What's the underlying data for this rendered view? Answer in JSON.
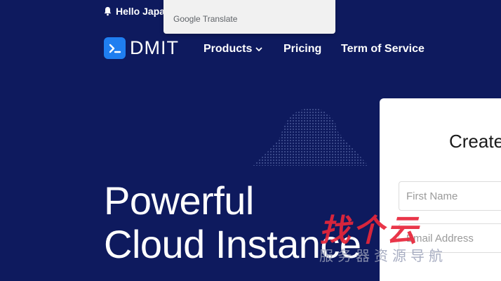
{
  "announcement": {
    "text": "Hello Japa",
    "icon": "bell-icon"
  },
  "google_translate": {
    "brand": "Google",
    "label": "Translate"
  },
  "brand": {
    "name": "DMIT",
    "accent": "#1f7ef0",
    "icon": "terminal-icon"
  },
  "nav": {
    "products": "Products",
    "pricing": "Pricing",
    "tos": "Term of Service"
  },
  "hero": {
    "line1": "Powerful",
    "line2": "Cloud Instance"
  },
  "signup": {
    "title": "Create",
    "first_name_placeholder": "First Name",
    "email_placeholder": "Email Address"
  },
  "watermark": {
    "main": "找个云",
    "sub": "服务器资源导航"
  },
  "colors": {
    "background": "#0e1a5e",
    "card": "#ffffff",
    "watermark": "#e8263a"
  }
}
